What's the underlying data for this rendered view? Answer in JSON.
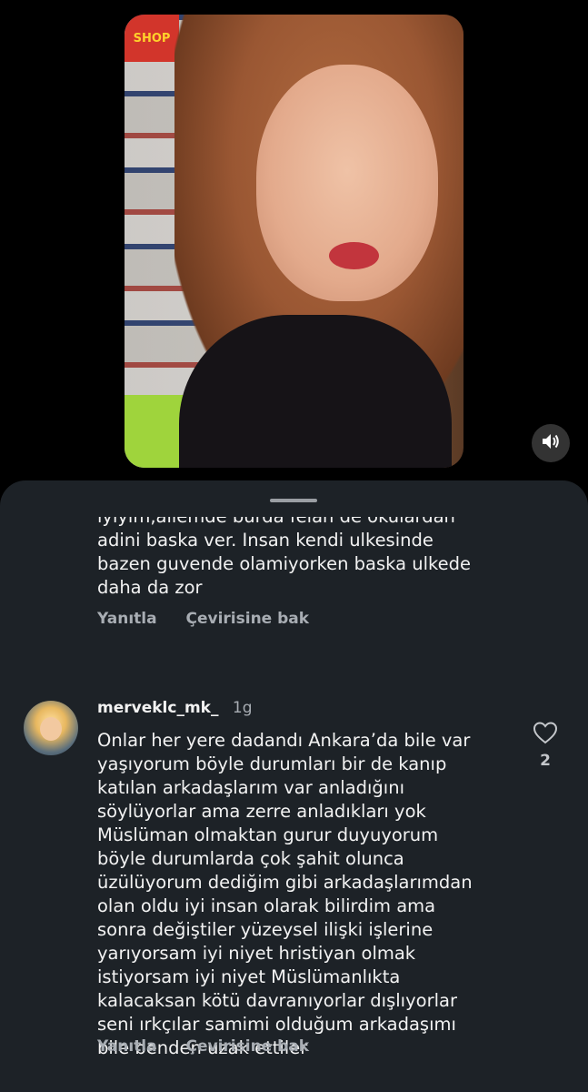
{
  "video": {
    "store_sign": "SHOP",
    "volume_icon": "speaker-volume-icon"
  },
  "comments": [
    {
      "text_partial": "iyiyim,ailemde burda felan de okulardan\nadini baska ver. Insan kendi ulkesinde\nbazen guvende olamiyorken baska ulkede\ndaha da zor",
      "reply_label": "Yanıtla",
      "translate_label": "Çevirisine bak"
    },
    {
      "username": "merveklc_mk_",
      "time": "1g",
      "text": "Onlar her yere dadandı Ankara’da bile var\nyaşıyorum böyle durumları bir de kanıp\nkatılan arkadaşlarım var anladığını\nsöylüyorlar ama zerre anladıkları yok\nMüslüman olmaktan gurur duyuyorum\nböyle durumlarda çok şahit olunca\nüzülüyorum dediğim gibi arkadaşlarımdan\nolan oldu  iyi insan olarak bilirdim ama\nsonra değiştiler yüzeysel ilişki işlerine\nyarıyorsam iyi niyet hristiyan olmak\nistiyorsam iyi niyet Müslümanlıkta\nkalacaksan kötü davranıyorlar dışlıyorlar\nseni ırkçılar samimi olduğum arkadaşımı\nbile benden uzak ettiler",
      "reply_label": "Yanıtla",
      "translate_label": "Çevirisine bak",
      "like_count": "2",
      "like_icon": "heart-outline-icon"
    }
  ]
}
